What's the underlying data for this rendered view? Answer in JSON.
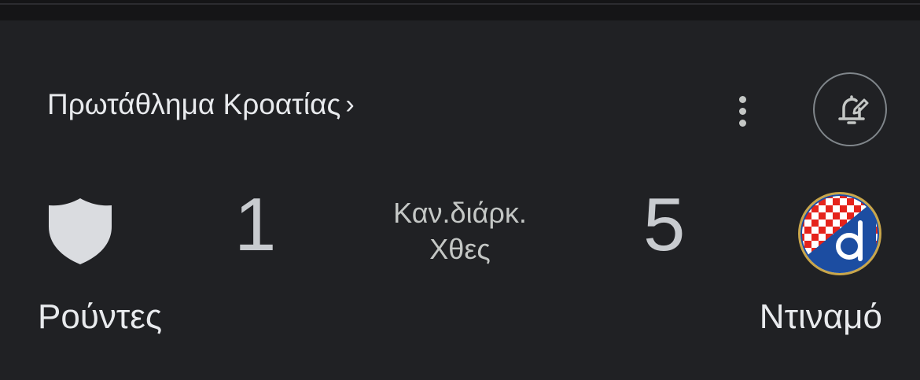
{
  "match": {
    "league": "Πρωτάθλημα Κροατίας",
    "league_chevron": "›",
    "status_line1": "Καν.διάρκ.",
    "status_line2": "Χθες",
    "home": {
      "name": "Ρούντες",
      "score": "1",
      "crest": "shield-icon"
    },
    "away": {
      "name": "Ντιναμό",
      "score": "5",
      "crest": "dinamo-crest-icon"
    }
  },
  "icons": {
    "more": "more-vert-icon",
    "notify": "bell-edit-icon"
  },
  "colors": {
    "background": "#202124",
    "text": "#e8eaed",
    "score": "#c8cbcf",
    "dinamo_blue": "#1c4da1",
    "dinamo_red": "#e5231b"
  }
}
